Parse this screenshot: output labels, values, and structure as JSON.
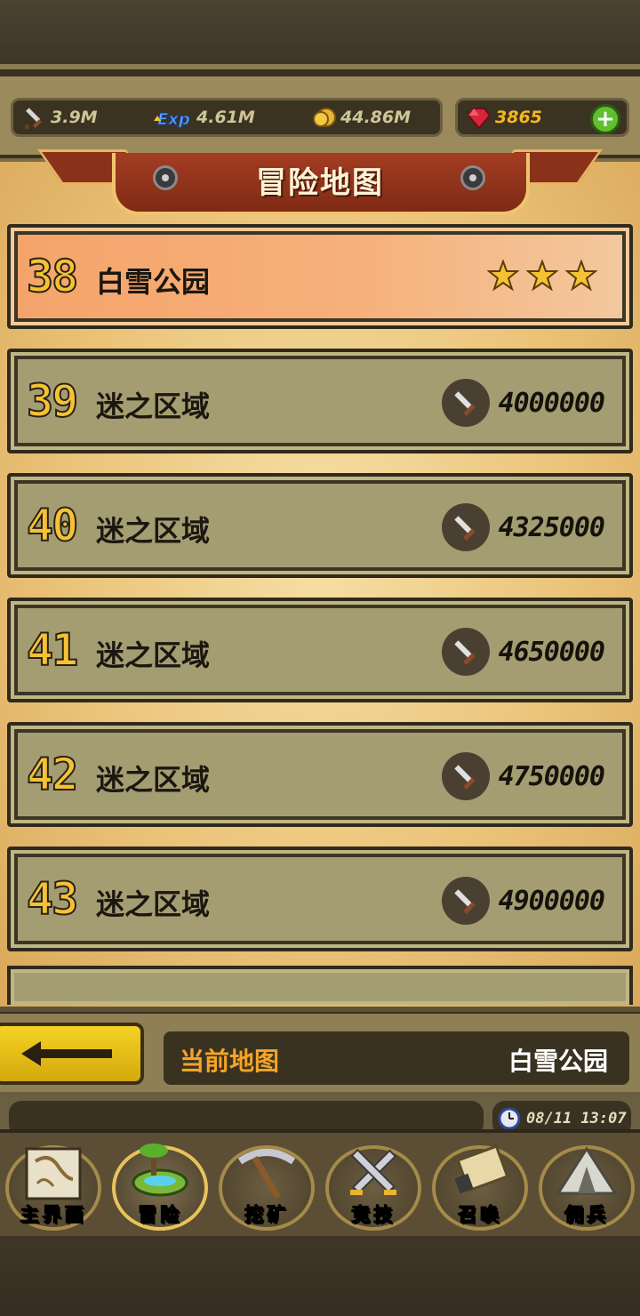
{
  "resources": {
    "attack": "3.9M",
    "exp": "4.61M",
    "gold": "44.86M",
    "gems": "3865"
  },
  "title": "冒险地图",
  "levels": [
    {
      "number": "38",
      "name": "白雪公园",
      "stars": 3,
      "cost": ""
    },
    {
      "number": "39",
      "name": "迷之区域",
      "cost": "4000000"
    },
    {
      "number": "40",
      "name": "迷之区域",
      "cost": "4325000"
    },
    {
      "number": "41",
      "name": "迷之区域",
      "cost": "4650000"
    },
    {
      "number": "42",
      "name": "迷之区域",
      "cost": "4750000"
    },
    {
      "number": "43",
      "name": "迷之区域",
      "cost": "4900000"
    }
  ],
  "current_map": {
    "label": "当前地图",
    "value": "白雪公园"
  },
  "clock": "08/11 13:07",
  "nav": [
    {
      "label": "主界面",
      "icon": "scroll-map-icon"
    },
    {
      "label": "冒险",
      "icon": "floating-island-icon"
    },
    {
      "label": "挖矿",
      "icon": "pickaxe-icon"
    },
    {
      "label": "竞技",
      "icon": "crossed-swords-icon"
    },
    {
      "label": "召唤",
      "icon": "summon-scroll-icon"
    },
    {
      "label": "佣兵",
      "icon": "tent-icon"
    }
  ],
  "colors": {
    "accent_gold": "#f5c233",
    "current_row": "#f4a46a",
    "locked_row": "#a59d72",
    "banner": "#a33d22"
  }
}
